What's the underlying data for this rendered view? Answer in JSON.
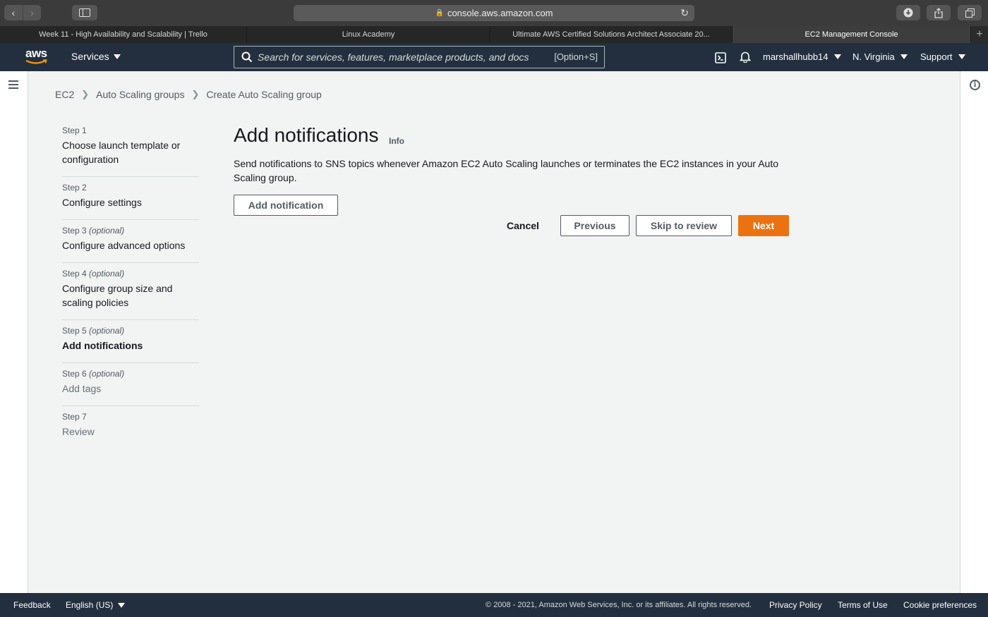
{
  "browser": {
    "url": "console.aws.amazon.com",
    "tabs": [
      {
        "label": "Week 11 - High Availability and Scalability | Trello"
      },
      {
        "label": "Linux Academy"
      },
      {
        "label": "Ultimate AWS Certified Solutions Architect Associate 20..."
      },
      {
        "label": "EC2 Management Console"
      }
    ]
  },
  "header": {
    "logo_text": "aws",
    "services_label": "Services",
    "search_placeholder": "Search for services, features, marketplace products, and docs",
    "search_shortcut": "[Option+S]",
    "account": "marshallhubb14",
    "region": "N. Virginia",
    "support": "Support"
  },
  "breadcrumb": {
    "items": [
      "EC2",
      "Auto Scaling groups",
      "Create Auto Scaling group"
    ]
  },
  "steps": [
    {
      "number": "Step 1",
      "optional": "",
      "title": "Choose launch template or configuration"
    },
    {
      "number": "Step 2",
      "optional": "",
      "title": "Configure settings"
    },
    {
      "number": "Step 3",
      "optional": "(optional)",
      "title": "Configure advanced options"
    },
    {
      "number": "Step 4",
      "optional": "(optional)",
      "title": "Configure group size and scaling policies"
    },
    {
      "number": "Step 5",
      "optional": "(optional)",
      "title": "Add notifications"
    },
    {
      "number": "Step 6",
      "optional": "(optional)",
      "title": "Add tags"
    },
    {
      "number": "Step 7",
      "optional": "",
      "title": "Review"
    }
  ],
  "main": {
    "title": "Add notifications",
    "info": "Info",
    "description": "Send notifications to SNS topics whenever Amazon EC2 Auto Scaling launches or terminates the EC2 instances in your Auto Scaling group.",
    "add_notification": "Add notification",
    "cancel": "Cancel",
    "previous": "Previous",
    "skip_to_review": "Skip to review",
    "next": "Next"
  },
  "footer": {
    "feedback": "Feedback",
    "language": "English (US)",
    "copyright": "© 2008 - 2021, Amazon Web Services, Inc. or its affiliates. All rights reserved.",
    "privacy": "Privacy Policy",
    "terms": "Terms of Use",
    "cookies": "Cookie preferences"
  },
  "colors": {
    "header_bg": "#232f3e",
    "primary": "#ec7211",
    "page_bg": "#f2f3f3"
  }
}
